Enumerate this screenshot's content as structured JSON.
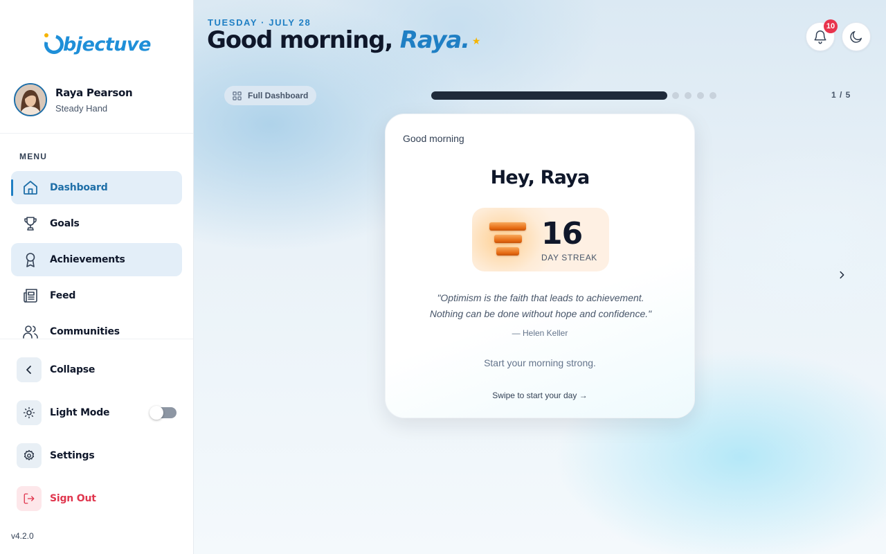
{
  "app": {
    "logo_text": "bjectuve",
    "version": "v4.2.0"
  },
  "profile": {
    "name": "Raya Pearson",
    "role": "Steady Hand"
  },
  "sidebar": {
    "menu_heading": "MENU",
    "items": [
      {
        "label": "Dashboard",
        "icon": "home-icon",
        "state": "active"
      },
      {
        "label": "Goals",
        "icon": "trophy-icon",
        "state": "default"
      },
      {
        "label": "Achievements",
        "icon": "award-icon",
        "state": "hover"
      },
      {
        "label": "Feed",
        "icon": "newspaper-icon",
        "state": "default"
      },
      {
        "label": "Communities",
        "icon": "users-icon",
        "state": "default"
      }
    ],
    "collapse_label": "Collapse",
    "light_mode_label": "Light Mode",
    "light_mode_on": false,
    "settings_label": "Settings",
    "signout_label": "Sign Out"
  },
  "header": {
    "date": "TUESDAY · JULY 28",
    "greeting_prefix": "Good morning, ",
    "greeting_name": "Raya.",
    "greeting_star": "★",
    "notification_count": "10"
  },
  "carousel": {
    "full_dashboard_label": "Full Dashboard",
    "current_page": "1",
    "separator": "/",
    "total_pages": "5",
    "page_counter": "1 / 5"
  },
  "card": {
    "greeting": "Good morning",
    "title": "Hey, Raya",
    "streak_number": "16",
    "streak_label": "DAY STREAK",
    "quote_line1": "\"Optimism is the faith that leads to achievement.",
    "quote_line2": "Nothing can be done without hope and confidence.\"",
    "quote_author": "— Helen Keller",
    "subtitle": "Start your morning strong.",
    "cta": "Swipe to start your day →"
  },
  "colors": {
    "accent": "#1f7fc4",
    "danger": "#e0364e",
    "streak_orange": "#e66a12",
    "badge": "#e8344d"
  }
}
